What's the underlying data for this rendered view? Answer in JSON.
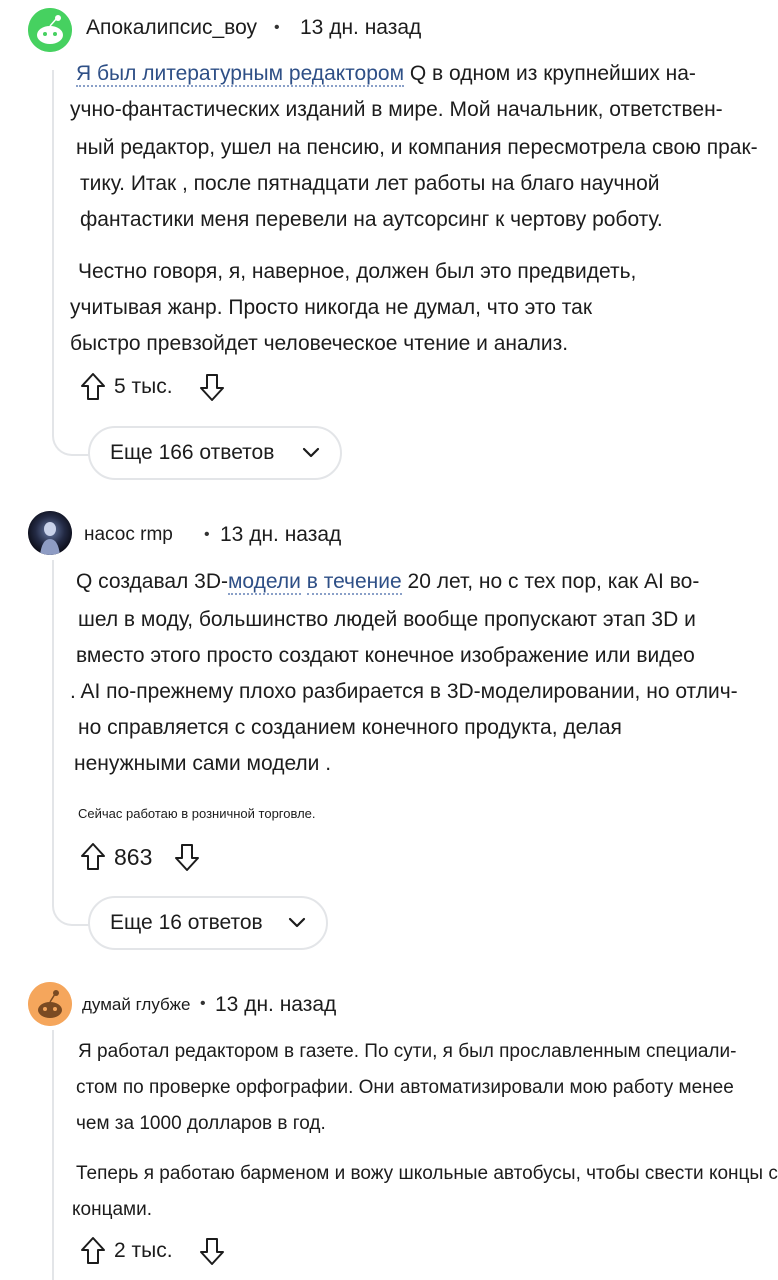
{
  "comments": [
    {
      "username": "Апокалипсис_воу",
      "time": "13 дн. назад",
      "paragraph1": [
        "Я был литературным редактором Q в одном из крупнейших на-",
        "учно-фантастических изданий в мире. Мой начальник, ответствен-",
        "ный редактор, ушел на пенсию, и компания пересмотрела свою прак-",
        "тику. Итак , после пятнадцати лет работы на благо научной",
        "фантастики меня перевели на аутсорсинг к чертову роботу."
      ],
      "paragraph2": [
        "Честно говоря, я, наверное, должен был это предвидеть,",
        "учитывая жанр. Просто никогда не думал, что это так",
        "быстро превзойдет человеческое чтение и анализ."
      ],
      "votes": "5 тыс.",
      "more_replies": "Еще 166 ответов"
    },
    {
      "username": "насос rmp",
      "time": "13 дн. назад",
      "paragraph1": [
        "Q создавал 3D-модели в течение 20 лет, но с тех пор, как AI во-",
        "шел в моду, большинство людей вообще пропускают этап 3D и",
        "вместо этого просто создают конечное изображение или видео",
        ". AI по-прежнему плохо разбирается в 3D-моделировании, но отлич-",
        "но справляется с созданием конечного продукта, делая",
        "ненужными сами модели ."
      ],
      "note": "Сейчас работаю в розничной торговле.",
      "votes": "863",
      "more_replies": "Еще 16 ответов"
    },
    {
      "username": "думай глубже",
      "time": "13 дн. назад",
      "paragraph1": [
        "Я работал редактором в газете. По сути, я был прославленным специали-",
        "стом по проверке орфографии. Они автоматизировали мою работу менее",
        "чем за 1000 долларов в год."
      ],
      "paragraph2": [
        "Теперь я работаю барменом и вожу школьные автобусы, чтобы свести концы с",
        "концами."
      ],
      "votes": "2 тыс."
    }
  ],
  "colors": {
    "link": "#2e4f86",
    "thread": "#e3e5e8",
    "avatar1": "#46d160",
    "avatar3": "#f5a65c"
  },
  "icons": [
    "reddit-avatar-icon",
    "upvote-arrow-icon",
    "downvote-arrow-icon",
    "chevron-down-icon"
  ]
}
